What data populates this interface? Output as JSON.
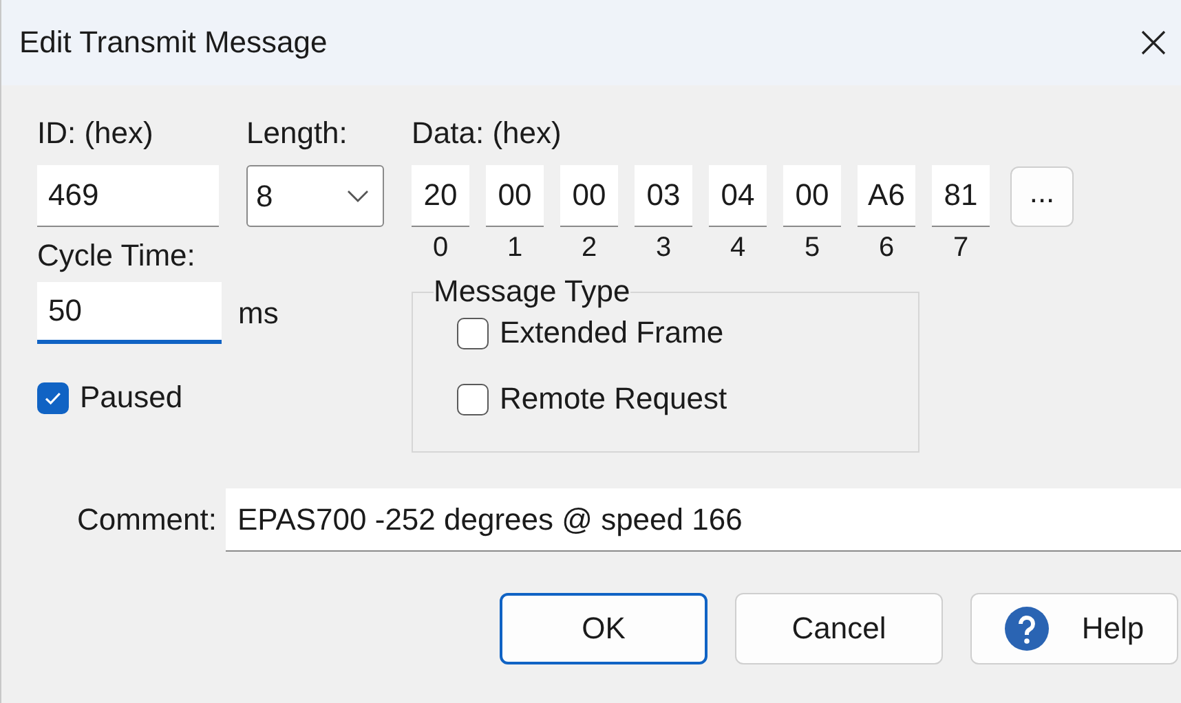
{
  "window": {
    "title": "Edit Transmit Message"
  },
  "id": {
    "label": "ID: (hex)",
    "value": "469"
  },
  "length": {
    "label": "Length:",
    "value": "8"
  },
  "data": {
    "label": "Data: (hex)",
    "more_button": "...",
    "bytes": [
      {
        "index": "0",
        "value": "20"
      },
      {
        "index": "1",
        "value": "00"
      },
      {
        "index": "2",
        "value": "00"
      },
      {
        "index": "3",
        "value": "03"
      },
      {
        "index": "4",
        "value": "04"
      },
      {
        "index": "5",
        "value": "00"
      },
      {
        "index": "6",
        "value": "A6"
      },
      {
        "index": "7",
        "value": "81"
      }
    ]
  },
  "cycle_time": {
    "label": "Cycle Time:",
    "value": "50",
    "unit": "ms",
    "focused": true
  },
  "paused": {
    "label": "Paused",
    "checked": true
  },
  "message_type": {
    "title": "Message Type",
    "options": [
      {
        "label": "Extended Frame",
        "checked": false
      },
      {
        "label": "Remote Request",
        "checked": false
      }
    ]
  },
  "comment": {
    "label": "Comment:",
    "value": "EPAS700 -252 degrees @ speed 166"
  },
  "buttons": [
    {
      "label": "OK",
      "kind": "default"
    },
    {
      "label": "Cancel",
      "kind": "plain"
    },
    {
      "label": "Help",
      "kind": "help"
    }
  ]
}
